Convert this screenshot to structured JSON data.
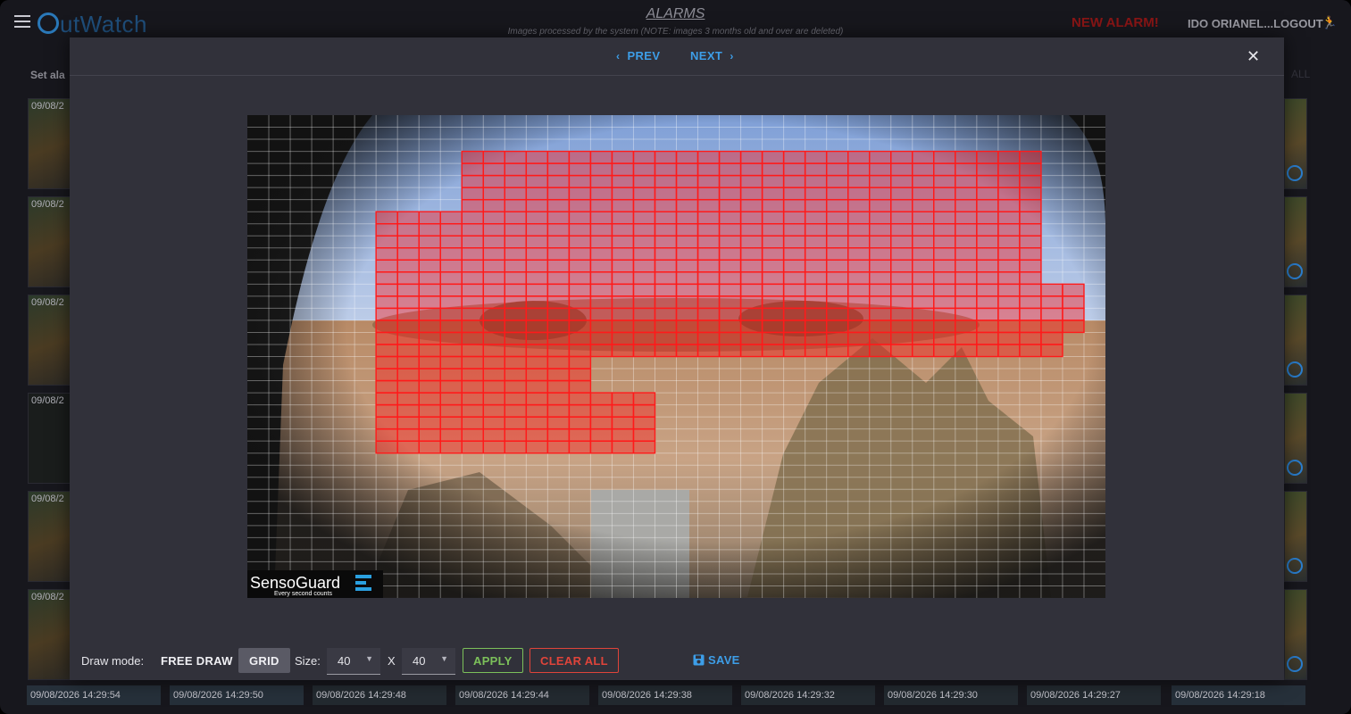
{
  "app": {
    "logo_prefix": "",
    "logo_text": "utWatch",
    "title": "ALARMS",
    "subtitle": "Images processed by the system (NOTE: images 3 months old and over are deleted)",
    "new_alarm": "NEW ALARM!",
    "user_label": "IDO ORIANEL",
    "logout_label": "...LOGOUT",
    "set_alarm_label": "Set ala",
    "all_label": "ALL"
  },
  "left_thumbs": [
    "09/08/2",
    "09/08/2",
    "09/08/2",
    "09/08/2",
    "09/08/2",
    "09/08/2"
  ],
  "bottom_timestamps": [
    "09/08/2026 14:29:54",
    "09/08/2026 14:29:50",
    "09/08/2026 14:29:48",
    "09/08/2026 14:29:44",
    "09/08/2026 14:29:38",
    "09/08/2026 14:29:32",
    "09/08/2026 14:29:30",
    "09/08/2026 14:29:27",
    "09/08/2026 14:29:18"
  ],
  "modal": {
    "prev_label": "PREV",
    "next_label": "NEXT",
    "close_label": "✕"
  },
  "image": {
    "watermark_brand": "SensoGuard",
    "watermark_tagline": "Every second counts",
    "grid_cols": 40,
    "grid_rows": 40,
    "selection_color": "#ff1a1a",
    "selected_runs": [
      [
        10,
        36,
        2,
        26
      ],
      [
        10,
        36,
        2,
        26
      ],
      [
        10,
        36,
        2,
        26
      ],
      [
        10,
        36,
        2,
        26
      ],
      [
        10,
        36,
        2,
        26
      ],
      [
        6,
        36,
        2,
        26
      ],
      [
        6,
        36,
        2,
        26
      ],
      [
        6,
        36,
        2,
        26
      ],
      [
        6,
        36,
        2,
        26
      ],
      [
        6,
        36,
        2,
        26
      ],
      [
        6,
        36,
        2,
        26
      ],
      [
        6,
        38,
        2,
        26
      ],
      [
        6,
        38,
        2,
        26
      ],
      [
        6,
        38,
        2,
        26
      ],
      [
        6,
        38,
        2,
        26
      ],
      [
        6,
        37,
        2,
        26
      ],
      [
        6,
        37,
        2,
        26
      ],
      [
        6,
        15,
        2,
        26
      ],
      [
        6,
        15,
        2,
        26
      ],
      [
        6,
        15,
        2,
        26
      ],
      [
        6,
        18,
        2,
        26
      ],
      [
        6,
        18,
        2,
        26
      ],
      [
        6,
        18,
        2,
        26
      ],
      [
        6,
        18,
        2,
        26
      ],
      [
        6,
        18,
        2,
        26
      ]
    ],
    "selected_row_start": 3
  },
  "toolbar": {
    "draw_mode_label": "Draw mode:",
    "free_draw_label": "FREE DRAW",
    "grid_label": "GRID",
    "size_label": "Size:",
    "size_x": "40",
    "x_sep": "X",
    "size_y": "40",
    "apply_label": "APPLY",
    "clear_all_label": "CLEAR ALL",
    "save_label": "SAVE"
  },
  "colors": {
    "accent_blue": "#3d9ee8",
    "apply_green": "#7cc05a",
    "clear_red": "#e0443a"
  }
}
